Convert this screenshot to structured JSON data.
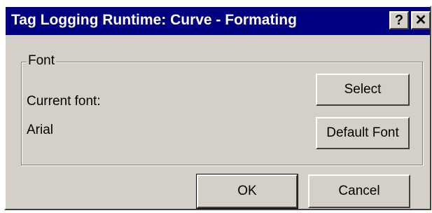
{
  "window": {
    "title": "Tag Logging Runtime: Curve - Formating",
    "help_glyph": "?",
    "close_glyph": "✕"
  },
  "font_group": {
    "label": "Font",
    "current_font_label": "Current font:",
    "current_font_value": "Arial",
    "select_label": "Select",
    "default_font_label": "Default Font"
  },
  "footer": {
    "ok_label": "OK",
    "cancel_label": "Cancel"
  },
  "colors": {
    "titlebar": "#000080",
    "face": "#d4d0c8"
  }
}
